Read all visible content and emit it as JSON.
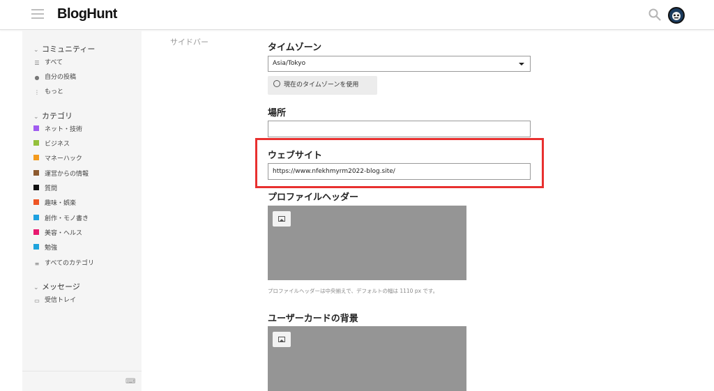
{
  "header": {
    "logo": "BlogHunt",
    "menu_icon": "hamburger-menu-icon",
    "search_icon": "search-icon",
    "avatar_icon": "user-avatar-icon"
  },
  "sidebar": {
    "community": {
      "title": "コミュニティー",
      "items": [
        {
          "label": "すべて",
          "icon": "layers-icon"
        },
        {
          "label": "自分の投稿",
          "icon": "user-icon"
        },
        {
          "label": "もっと",
          "icon": "more-vertical-icon"
        }
      ]
    },
    "categories": {
      "title": "カテゴリ",
      "items": [
        {
          "label": "ネット・技術",
          "color": "#a05cf0"
        },
        {
          "label": "ビジネス",
          "color": "#94c03b"
        },
        {
          "label": "マネーハック",
          "color": "#f39a1d"
        },
        {
          "label": "運営からの情報",
          "color": "#8d5a2f"
        },
        {
          "label": "質問",
          "color": "#111111"
        },
        {
          "label": "趣味・娯楽",
          "color": "#ee5524"
        },
        {
          "label": "創作・モノ書き",
          "color": "#1ea1e0"
        },
        {
          "label": "美容・ヘルス",
          "color": "#e8196f"
        },
        {
          "label": "勉強",
          "color": "#1fa3dc"
        },
        {
          "label": "すべてのカテゴリ",
          "icon": "list-icon"
        }
      ]
    },
    "messages": {
      "title": "メッセージ",
      "items": [
        {
          "label": "受信トレイ",
          "icon": "inbox-icon"
        }
      ]
    },
    "keyboard_icon": "keyboard-icon"
  },
  "main": {
    "side_label": "サイドバー",
    "timezone": {
      "label": "タイムゾーン",
      "value": "Asia/Tokyo",
      "button_label": "現在のタイムゾーンを使用"
    },
    "location": {
      "label": "場所",
      "value": ""
    },
    "website": {
      "label": "ウェブサイト",
      "value": "https://www.nfekhmyrm2022-blog.site/"
    },
    "profile_header": {
      "label": "プロファイルヘッダー",
      "hint": "プロファイルヘッダーは中央揃えで、デフォルトの幅は 1110 px です。"
    },
    "user_card": {
      "label": "ユーザーカードの背景"
    },
    "highlight_color": "#e8302f"
  }
}
